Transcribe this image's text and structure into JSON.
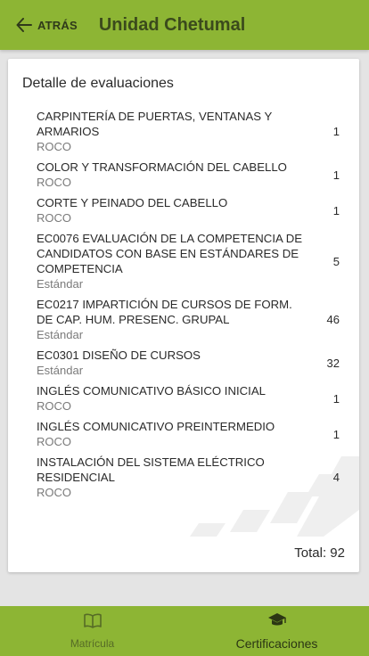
{
  "header": {
    "back_label": "ATRÁS",
    "back_icon": "arrow-left-icon",
    "title": "Unidad Chetumal"
  },
  "card": {
    "title": "Detalle de evaluaciones",
    "total_label": "Total: 92"
  },
  "evaluations": [
    {
      "name": "CARPINTERÍA DE PUERTAS, VENTANAS Y ARMARIOS",
      "type": "ROCO",
      "count": "1"
    },
    {
      "name": "COLOR Y TRANSFORMACIÓN DEL CABELLO",
      "type": "ROCO",
      "count": "1"
    },
    {
      "name": "CORTE Y PEINADO DEL CABELLO",
      "type": "ROCO",
      "count": "1"
    },
    {
      "name": "EC0076 EVALUACIÓN DE LA COMPETENCIA DE CANDIDATOS CON BASE EN ESTÁNDARES DE COMPETENCIA",
      "type": "Estándar",
      "count": "5"
    },
    {
      "name": "EC0217 IMPARTICIÓN DE CURSOS DE FORM. DE CAP. HUM. PRESENC. GRUPAL",
      "type": "Estándar",
      "count": "46"
    },
    {
      "name": "EC0301 DISEÑO DE CURSOS",
      "type": "Estándar",
      "count": "32"
    },
    {
      "name": "INGLÉS COMUNICATIVO BÁSICO INICIAL",
      "type": "ROCO",
      "count": "1"
    },
    {
      "name": "INGLÉS COMUNICATIVO PREINTERMEDIO",
      "type": "ROCO",
      "count": "1"
    },
    {
      "name": "INSTALACIÓN DEL SISTEMA ELÉCTRICO RESIDENCIAL",
      "type": "ROCO",
      "count": "4"
    }
  ],
  "bottom_nav": {
    "items": [
      {
        "label": "Matrícula",
        "icon": "book-icon",
        "active": false
      },
      {
        "label": "Certificaciones",
        "icon": "graduation-cap-icon",
        "active": true
      }
    ]
  },
  "colors": {
    "brand_green": "#8db534",
    "background": "#e4e4e4",
    "card": "#ffffff"
  }
}
